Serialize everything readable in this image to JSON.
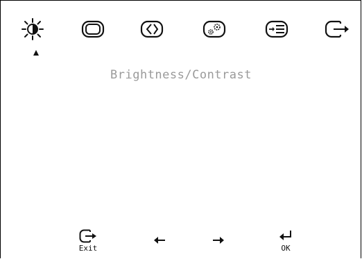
{
  "menu": {
    "title": "Brightness/Contrast",
    "tabs": [
      {
        "icon": "brightness-icon",
        "selected": true
      },
      {
        "icon": "image-position-icon",
        "selected": false
      },
      {
        "icon": "image-setup-icon",
        "selected": false
      },
      {
        "icon": "options-icon",
        "selected": false
      },
      {
        "icon": "input-signal-icon",
        "selected": false
      },
      {
        "icon": "exit-icon",
        "selected": false
      }
    ]
  },
  "footer": {
    "exit_label": "Exit",
    "ok_label": "OK"
  }
}
